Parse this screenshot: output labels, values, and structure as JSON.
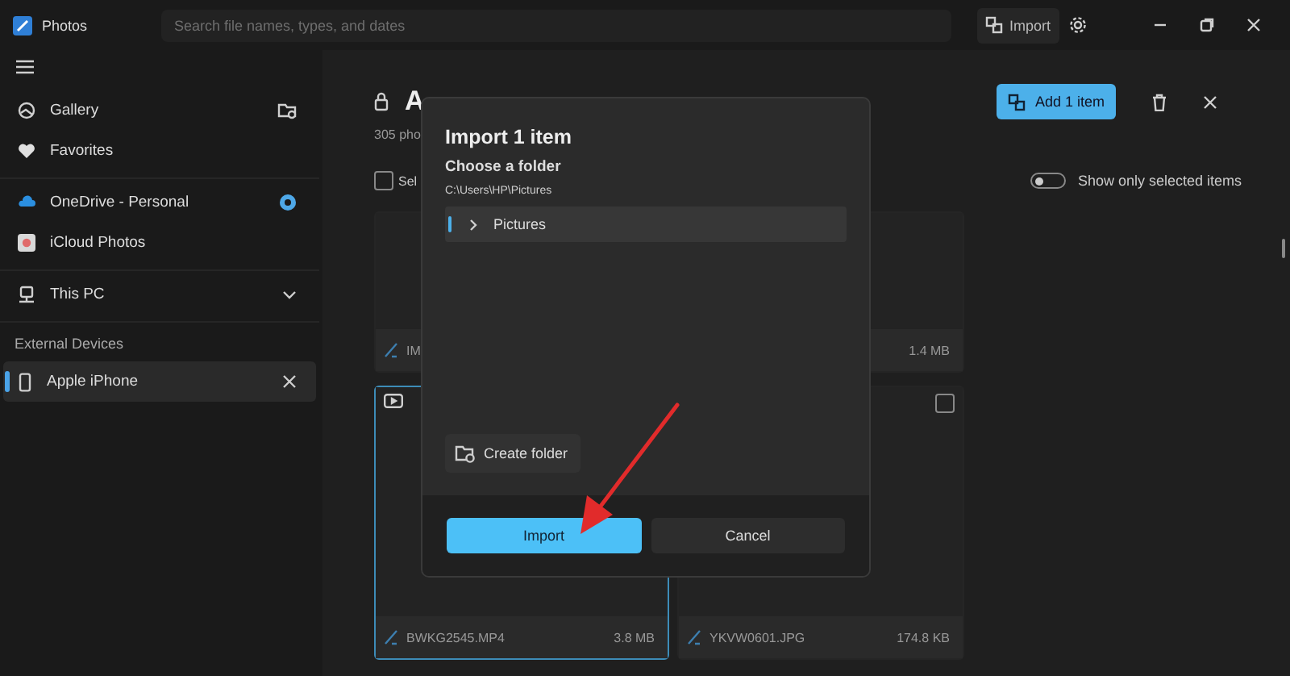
{
  "window": {
    "title": "Photos"
  },
  "search": {
    "placeholder": "Search file names, types, and dates"
  },
  "toolbar": {
    "import_label": "Import"
  },
  "sidebar": {
    "groups": [
      {
        "items": [
          {
            "label": "Gallery",
            "selected": false
          },
          {
            "label": "Favorites",
            "selected": false
          }
        ]
      },
      {
        "items": [
          {
            "label": "OneDrive - Personal",
            "selected": false
          },
          {
            "label": "iCloud Photos",
            "selected": false
          }
        ]
      },
      {
        "items": [
          {
            "label": "This PC",
            "selected": false,
            "expanded": false
          }
        ]
      },
      {
        "heading": "External Devices",
        "items": [
          {
            "label": "Apple iPhone",
            "selected": true
          }
        ]
      }
    ]
  },
  "main": {
    "title": "A",
    "subtitle": "305 pho",
    "add_button": "Add 1 item",
    "select_all": {
      "label": "Sel",
      "checked": false
    },
    "toggle": {
      "label": "Show only selected items",
      "on": false
    },
    "cards": [
      {
        "name": "IM",
        "selected": false
      },
      {
        "size": "1.4 MB",
        "selected": false
      },
      {
        "kind": "video",
        "name": "BWKG2545.MP4",
        "size": "3.8 MB",
        "selected": true
      },
      {
        "kind": "photo",
        "name": "YKVW0601.JPG",
        "size": "174.8 KB",
        "selected": false
      }
    ]
  },
  "dialog": {
    "title": "Import 1 item",
    "subtitle": "Choose a folder",
    "path": "C:\\Users\\HP\\Pictures",
    "folders": [
      {
        "label": "Pictures",
        "selected": true,
        "expanded": false
      }
    ],
    "create_folder": "Create folder",
    "primary": "Import",
    "secondary": "Cancel"
  }
}
